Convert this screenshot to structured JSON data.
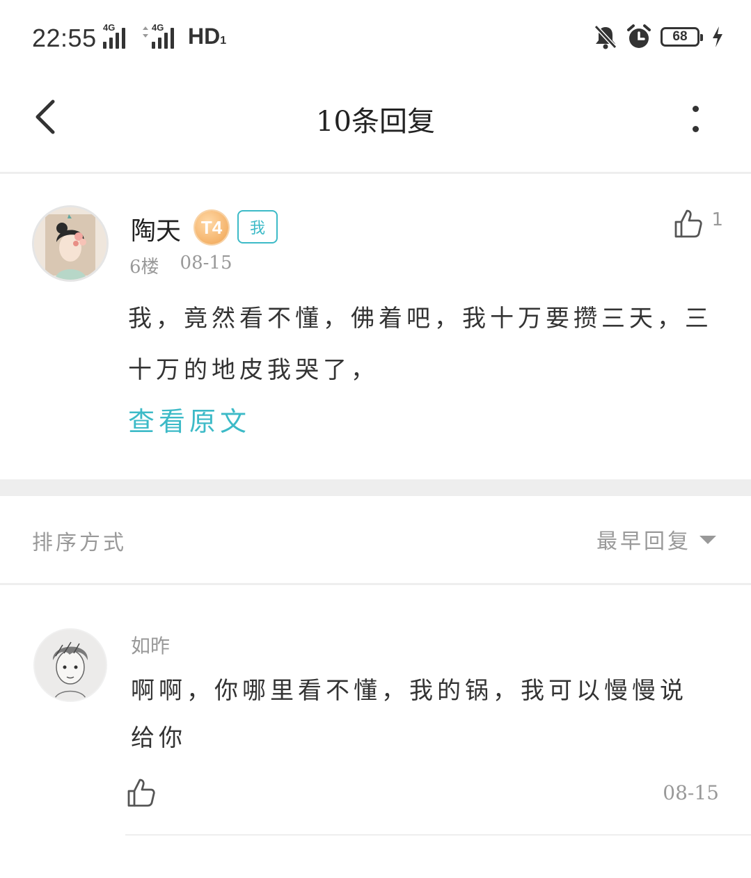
{
  "status_bar": {
    "time": "22:55",
    "net1_label": "4G",
    "net2_label": "4G",
    "hd_label": "HD",
    "hd_sub": "1",
    "battery": "68",
    "icons": [
      "mute-bell-icon",
      "alarm-icon",
      "battery-icon",
      "charging-icon"
    ]
  },
  "header": {
    "title": "10条回复"
  },
  "post": {
    "author": "陶天",
    "level_badge": "T4",
    "me_badge": "我",
    "floor": "6楼",
    "date": "08-15",
    "like_count": "1",
    "content": "我，竟然看不懂，佛着吧，我十万要攒三天，三十万的地皮我哭了，",
    "view_original": "查看原文"
  },
  "sort": {
    "label": "排序方式",
    "value": "最早回复"
  },
  "replies": [
    {
      "author": "如昨",
      "content": "啊啊，你哪里看不懂，我的锅，我可以慢慢说给你",
      "date": "08-15"
    }
  ]
}
